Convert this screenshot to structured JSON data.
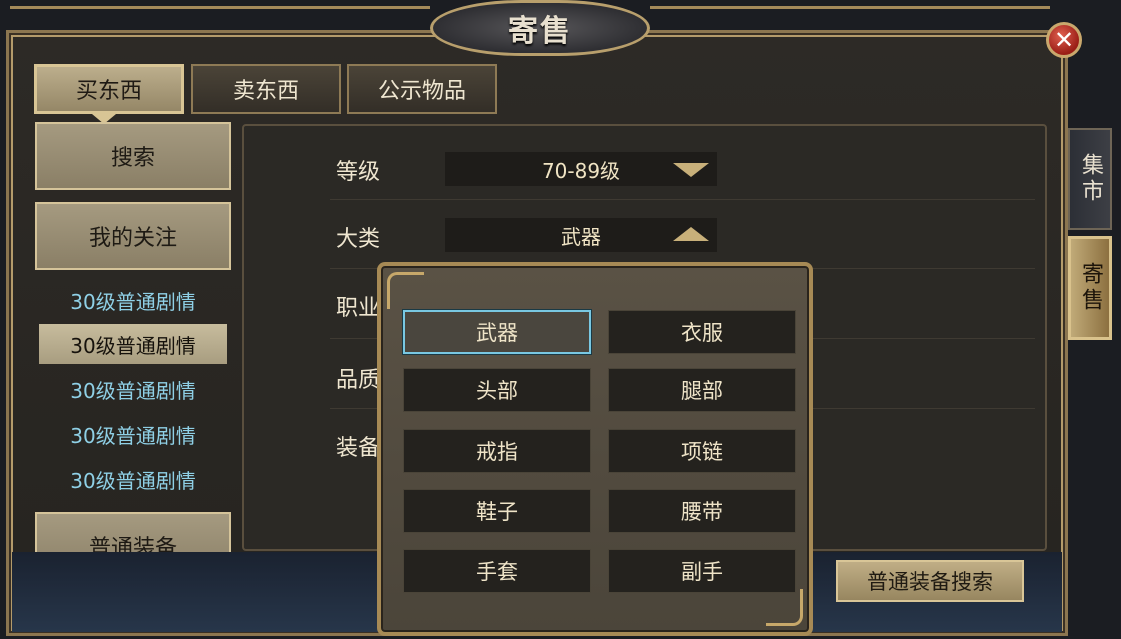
{
  "window": {
    "title": "寄售",
    "close_icon": "close-icon"
  },
  "tabs": [
    {
      "label": "买东西",
      "active": true
    },
    {
      "label": "卖东西",
      "active": false
    },
    {
      "label": "公示物品",
      "active": false
    }
  ],
  "sidebar": {
    "search_label": "搜索",
    "favorites_label": "我的关注",
    "items": [
      {
        "label": "30级普通剧情",
        "selected": false
      },
      {
        "label": "30级普通剧情",
        "selected": true
      },
      {
        "label": "30级普通剧情",
        "selected": false
      },
      {
        "label": "30级普通剧情",
        "selected": false
      },
      {
        "label": "30级普通剧情",
        "selected": false
      }
    ],
    "bottom_label": "普通装备"
  },
  "filters": {
    "level_label": "等级",
    "level_value": "70-89级",
    "category_label": "大类",
    "category_value": "武器",
    "class_label": "职业",
    "quality_label": "品质",
    "equip_label": "装备"
  },
  "dropdown": {
    "options": [
      "武器",
      "衣服",
      "头部",
      "腿部",
      "戒指",
      "项链",
      "鞋子",
      "腰带",
      "手套",
      "副手"
    ],
    "selected": "武器"
  },
  "right_tabs": {
    "market": "集市",
    "consign": "寄售"
  },
  "actions": {
    "search_button": "普通装备搜索"
  },
  "colors": {
    "accent_gold": "#d8c595",
    "selected_border": "#79c8e2",
    "list_text": "#8fd0e6"
  }
}
